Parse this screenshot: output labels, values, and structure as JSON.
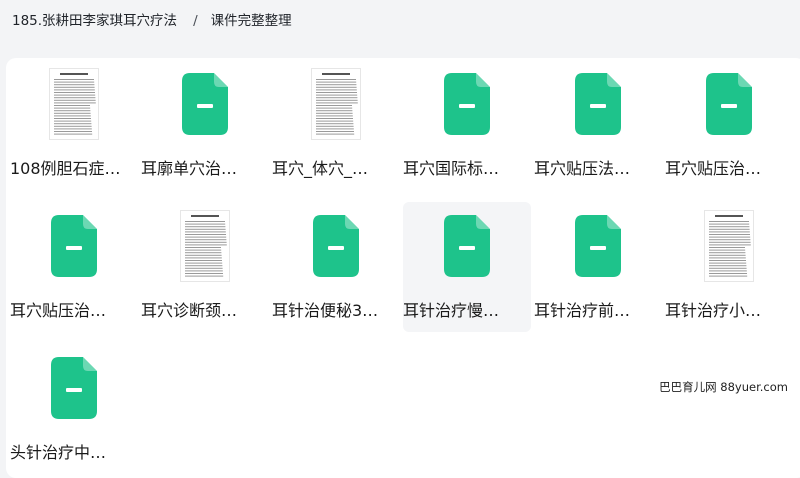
{
  "breadcrumb": {
    "folder": "185.张耕田李家琪耳穴疗法",
    "separator": "/",
    "current": "课件完整整理"
  },
  "colors": {
    "doc_icon": "#1ec38b",
    "background": "#f3f4f6"
  },
  "files": [
    {
      "name": "108例胆石症…",
      "thumb": "scan"
    },
    {
      "name": "耳廓单穴治…",
      "thumb": "doc-icon"
    },
    {
      "name": "耳穴_体穴_…",
      "thumb": "scan"
    },
    {
      "name": "耳穴国际标…",
      "thumb": "doc-icon"
    },
    {
      "name": "耳穴贴压法…",
      "thumb": "doc-icon"
    },
    {
      "name": "耳穴贴压治…",
      "thumb": "doc-icon"
    },
    {
      "name": "耳穴贴压治…",
      "thumb": "doc-icon"
    },
    {
      "name": "耳穴诊断颈…",
      "thumb": "scan"
    },
    {
      "name": "耳针治便秘3…",
      "thumb": "doc-icon"
    },
    {
      "name": "耳针治疗慢…",
      "thumb": "doc-icon",
      "hover": true
    },
    {
      "name": "耳针治疗前…",
      "thumb": "doc-icon"
    },
    {
      "name": "耳针治疗小…",
      "thumb": "scan"
    },
    {
      "name": "头针治疗中…",
      "thumb": "doc-icon"
    }
  ],
  "watermark": "巴巴育儿网 88yuer.com"
}
